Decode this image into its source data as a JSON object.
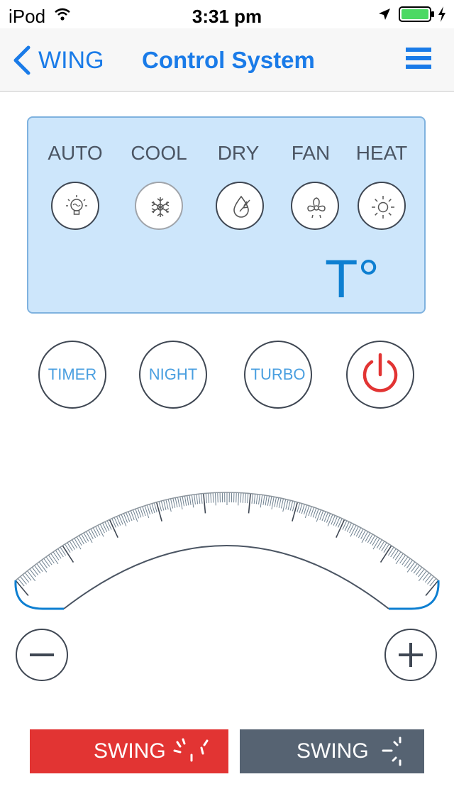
{
  "status_bar": {
    "carrier": "iPod",
    "time": "3:31 pm",
    "icons": [
      "wifi-icon",
      "location-icon",
      "battery-icon",
      "charging-icon"
    ]
  },
  "nav": {
    "back_label": "WING",
    "title": "Control System",
    "menu_icon": "hamburger-menu-icon"
  },
  "modes": [
    {
      "label": "AUTO",
      "icon": "bulb-icon"
    },
    {
      "label": "COOL",
      "icon": "snowflake-icon"
    },
    {
      "label": "DRY",
      "icon": "droplet-icon"
    },
    {
      "label": "FAN",
      "icon": "fan-icon"
    },
    {
      "label": "HEAT",
      "icon": "sun-icon"
    }
  ],
  "selected_mode": "COOL",
  "temperature_display": "T°",
  "functions": {
    "timer": "TIMER",
    "night": "NIGHT",
    "turbo": "TURBO",
    "power_icon": "power-icon"
  },
  "controls": {
    "decrease_icon": "minus-icon",
    "increase_icon": "plus-icon"
  },
  "swing": {
    "vertical_label": "SWING",
    "horizontal_label": "SWING"
  },
  "colors": {
    "accent": "#1a7be8",
    "panel": "#cde6fb",
    "power": "#e23433",
    "swing_active": "#e23433",
    "swing_inactive": "#566372"
  }
}
